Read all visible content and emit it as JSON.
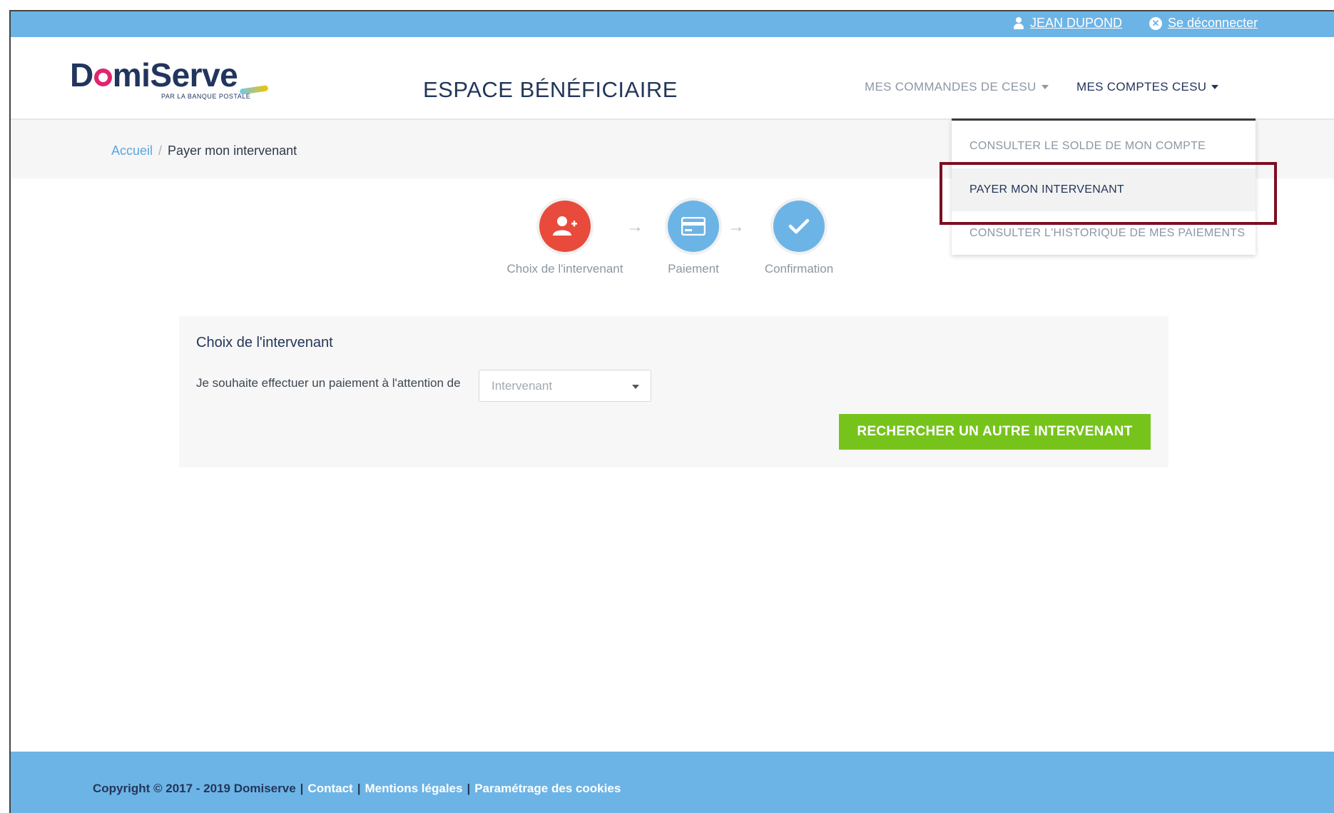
{
  "topbar": {
    "user_name": "JEAN DUPOND",
    "logout_label": "Se déconnecter",
    "background": "#6db4e6"
  },
  "header": {
    "logo_text_before": "D",
    "logo_text_after": "miServe",
    "logo_subtitle": "PAR LA BANQUE POSTALE",
    "title": "ESPACE BÉNÉFICIAIRE",
    "nav": {
      "commandes": "MES COMMANDES DE CESU",
      "comptes": "MES COMPTES CESU"
    }
  },
  "breadcrumb": {
    "home": "Accueil",
    "separator": "/",
    "current": "Payer mon intervenant"
  },
  "stepper": {
    "steps": [
      {
        "label": "Choix de l'intervenant",
        "icon": "add-user-icon",
        "color": "#e84b3c"
      },
      {
        "label": "Paiement",
        "icon": "credit-card-icon",
        "color": "#6db4e6"
      },
      {
        "label": "Confirmation",
        "icon": "check-icon",
        "color": "#6db4e6"
      }
    ],
    "arrow": "→"
  },
  "panel": {
    "title": "Choix de l'intervenant",
    "label": "Je souhaite effectuer un paiement à l'attention de",
    "select_placeholder": "Intervenant",
    "search_button": "RECHERCHER UN AUTRE INTERVENANT",
    "button_color": "#76c41b"
  },
  "dropdown": {
    "items": [
      "CONSULTER LE SOLDE DE MON COMPTE",
      "PAYER MON INTERVENANT",
      "CONSULTER L'HISTORIQUE DE MES PAIEMENTS"
    ],
    "highlight_color": "#7b0f22"
  },
  "footer": {
    "copyright": "Copyright © 2017 - 2019 Domiserve",
    "separator": "|",
    "links": [
      "Contact",
      "Mentions légales",
      "Paramétrage des cookies"
    ]
  }
}
